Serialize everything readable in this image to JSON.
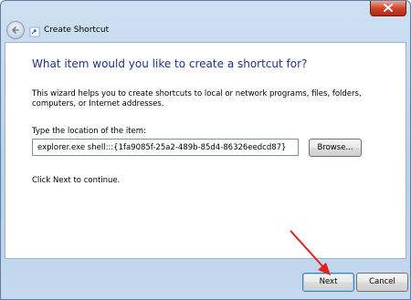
{
  "window": {
    "title": "Create Shortcut"
  },
  "wizard": {
    "heading": "What item would you like to create a shortcut for?",
    "description": "This wizard helps you to create shortcuts to local or network programs, files, folders, computers, or Internet addresses.",
    "location_label": "Type the location of the item:",
    "location_value": "explorer.exe shell:::{1fa9085f-25a2-489b-85d4-86326eedcd87}",
    "browse_label": "Browse...",
    "continue_hint": "Click Next to continue."
  },
  "footer": {
    "next_label": "Next",
    "cancel_label": "Cancel"
  },
  "annotation": {
    "arrow_color": "#e0231c"
  }
}
